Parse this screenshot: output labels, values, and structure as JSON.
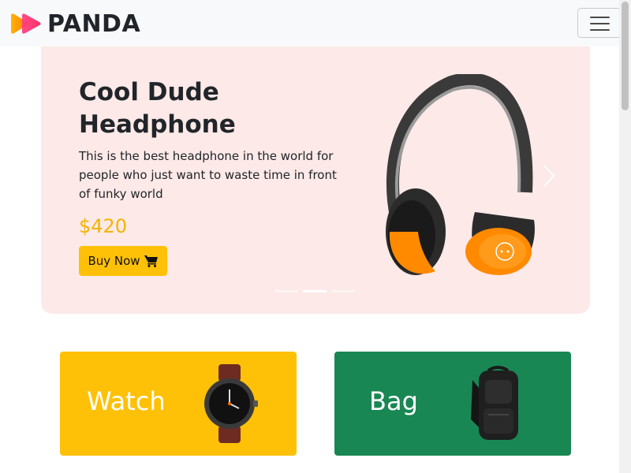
{
  "navbar": {
    "brand": "PANDA",
    "logo_icon": "play-triangles-logo",
    "menu_icon": "hamburger-menu-icon"
  },
  "hero": {
    "title": "Cool Dude Headphone",
    "description": "This is the best headphone in the world for people who just want to waste time in front of funky world",
    "price": "$420",
    "buy_label": "Buy Now",
    "cart_icon": "cart-icon",
    "image": "orange-headphone",
    "slides_count": 3,
    "active_slide": 2
  },
  "categories": [
    {
      "label": "Watch",
      "image": "wristwatch",
      "color": "#ffc107"
    },
    {
      "label": "Bag",
      "image": "backpack",
      "color": "#198754"
    }
  ],
  "colors": {
    "hero_bg": "#fce9e8",
    "accent": "#ffc107",
    "price": "#f5b301",
    "navbar_bg": "#f8f9fa"
  }
}
